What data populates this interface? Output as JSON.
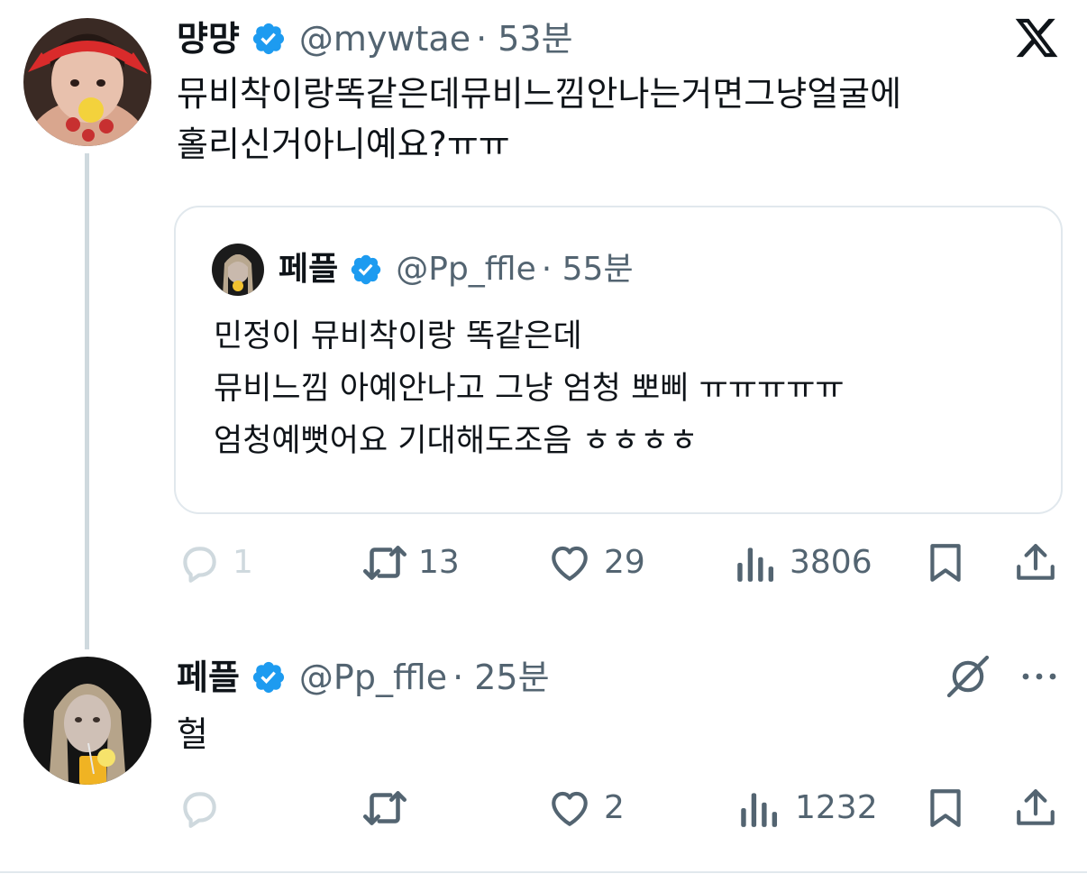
{
  "brand_icon": "x-logo-icon",
  "colors": {
    "verified": "#1d9bf0",
    "muted": "#536471",
    "text": "#0f1419",
    "faded": "#cfd9de"
  },
  "tweet1": {
    "name": "먕먕",
    "handle": "@mywtae",
    "time": "· 53분",
    "text_line1": "뮤비착이랑똑같은데뮤비느낌안나는거면그냥얼굴에",
    "text_line2": "홀리신거아니예요?ㅠㅠ",
    "quote": {
      "name": "페플",
      "handle": "@Pp_ffle",
      "time": "· 55분",
      "line1": "민정이 뮤비착이랑 똑같은데",
      "line2": "뮤비느낌 아예안나고 그냥 엄청 뽀삐 ㅠㅠㅠㅠㅠ",
      "line3": "엄청예뻣어요 기대해도조음 ㅎㅎㅎㅎ"
    },
    "actions": {
      "replies": "1",
      "reposts": "13",
      "likes": "29",
      "views": "3806"
    }
  },
  "tweet2": {
    "name": "페플",
    "handle": "@Pp_ffle",
    "time": "· 25분",
    "text": "헐",
    "actions": {
      "replies": "",
      "reposts": "",
      "likes": "2",
      "views": "1232"
    }
  }
}
